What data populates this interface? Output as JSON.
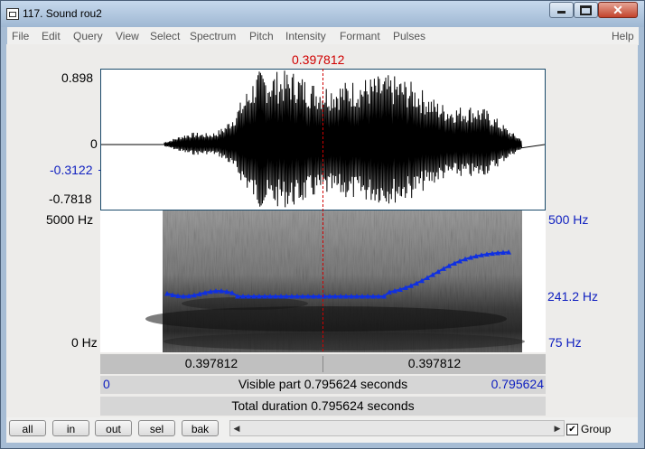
{
  "window": {
    "title": "117. Sound rou2",
    "close_glyph": "✕"
  },
  "menu": [
    "File",
    "Edit",
    "Query",
    "View",
    "Select",
    "Spectrum",
    "Pitch",
    "Intensity",
    "Formant",
    "Pulses",
    "Help"
  ],
  "cursor_time": "0.397812",
  "waveform": {
    "max_label": "0.898",
    "zero_label": "0",
    "cursor_value_label": "-0.3122",
    "min_label": "-0.7818"
  },
  "spectrogram": {
    "freq_max_label": "5000 Hz",
    "freq_min_label": "0 Hz"
  },
  "pitch": {
    "max_label": "500 Hz",
    "cursor_label": "241.2 Hz",
    "min_label": "75 Hz"
  },
  "time_bar": {
    "left_label": "0.397812",
    "right_label": "0.397812"
  },
  "visible_bar": {
    "start": "0",
    "text": "Visible part 0.795624 seconds",
    "end": "0.795624"
  },
  "total_bar": {
    "text": "Total duration 0.795624 seconds"
  },
  "buttons": {
    "all": "all",
    "in": "in",
    "out": "out",
    "sel": "sel",
    "bak": "bak"
  },
  "scroll_arrows": {
    "left": "◀",
    "right": "▶"
  },
  "group": {
    "label": "Group",
    "checked": true,
    "check_glyph": "✔"
  },
  "colors": {
    "cursor": "#d00000",
    "pitch_curve": "#1030e0",
    "blue_label": "#1020c0"
  }
}
